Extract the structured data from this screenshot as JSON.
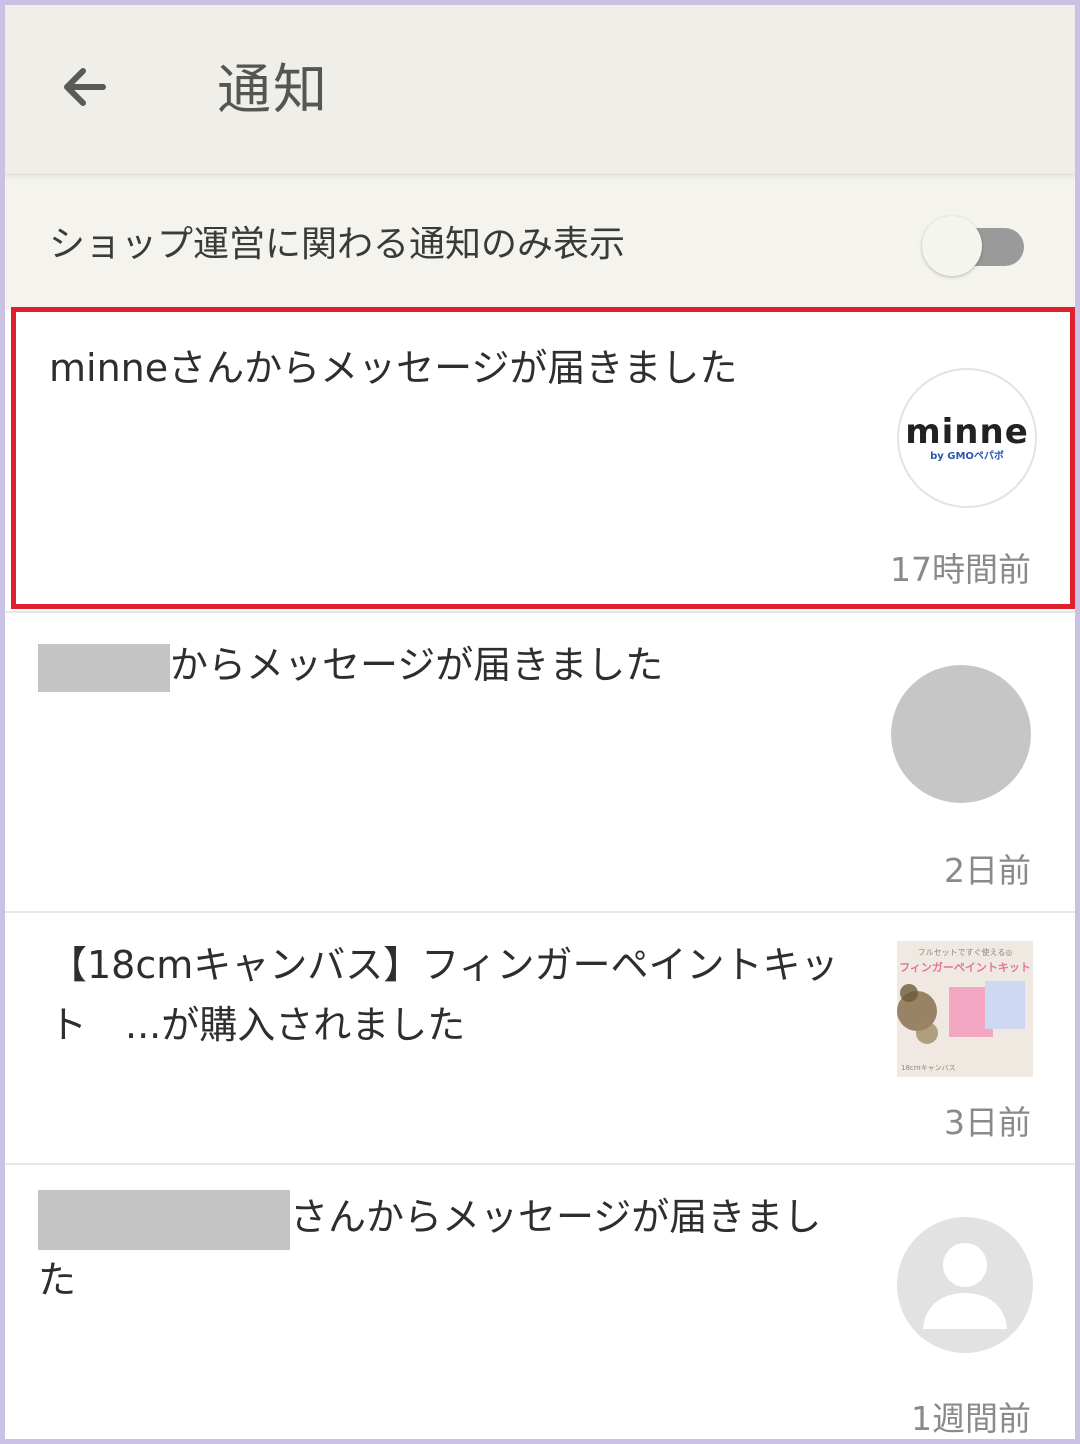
{
  "header": {
    "back_icon": "arrow-left-icon",
    "title": "通知"
  },
  "filter": {
    "label": "ショップ運営に関わる通知のみ表示",
    "toggle_on": false
  },
  "notifications": [
    {
      "text": "minneさんからメッセージが届きました",
      "time": "17時間前",
      "image": "minne-logo",
      "logo_text": "minne",
      "logo_sub": "by GMOペパボ",
      "highlighted": true
    },
    {
      "redacted_prefix": true,
      "text": "からメッセージが届きました",
      "time": "2日前",
      "image": "gray-avatar"
    },
    {
      "text": "【18cmキャンバス】フィンガーペイントキット　...が購入されました",
      "time": "3日前",
      "image": "product-thumbnail",
      "thumb_top": "フルセットですぐ使える◎",
      "thumb_title": "フィンガーペイントキット",
      "thumb_bottom": "18cmキャンバス"
    },
    {
      "redacted_prefix": true,
      "text": "さんからメッセージが届きました",
      "time": "1週間前",
      "image": "default-user-icon"
    }
  ],
  "colors": {
    "highlight": "#e0202c",
    "appbar": "#efeee8",
    "frame": "#c9c2e4"
  }
}
